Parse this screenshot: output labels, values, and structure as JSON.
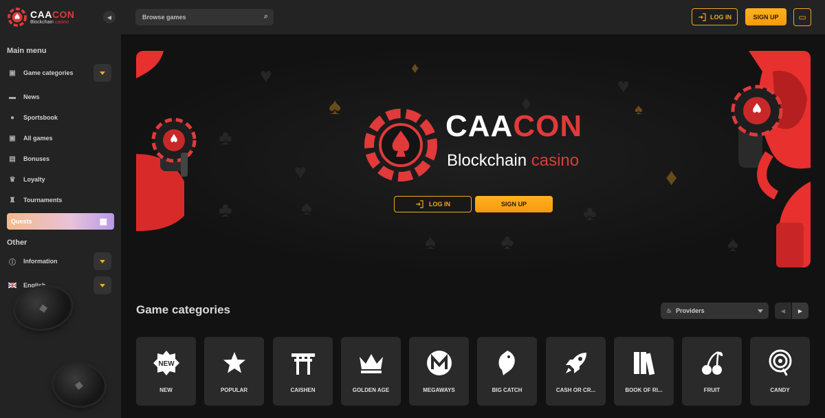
{
  "brand": {
    "name_white": "CAA",
    "name_red": "CON",
    "sub_white": "Blockchain",
    "sub_red": "casino",
    "accent": "#f5a623",
    "red": "#e03a3a"
  },
  "sidebar": {
    "main_menu_title": "Main menu",
    "items": [
      {
        "label": "Game categories",
        "icon": "gamepad-icon",
        "expandable": true
      },
      {
        "label": "News",
        "icon": "chat-bubble-icon",
        "expandable": false
      },
      {
        "label": "Sportsbook",
        "icon": "ball-icon",
        "expandable": false
      },
      {
        "label": "All games",
        "icon": "gamepad-icon",
        "expandable": false
      },
      {
        "label": "Bonuses",
        "icon": "gift-icon",
        "expandable": false
      },
      {
        "label": "Loyalty",
        "icon": "crown-icon",
        "expandable": false
      },
      {
        "label": "Tournaments",
        "icon": "trophy-icon",
        "expandable": false
      }
    ],
    "quests_label": "Quests",
    "other_title": "Other",
    "other_items": [
      {
        "label": "Information",
        "icon": "info-icon",
        "expandable": true
      },
      {
        "label": "English",
        "icon": "uk-flag-icon",
        "expandable": true
      }
    ]
  },
  "topbar": {
    "search_placeholder": "Browse games",
    "login_label": "LOG IN",
    "signup_label": "SIGN UP"
  },
  "hero": {
    "login_label": "LOG IN",
    "signup_label": "SIGN UP"
  },
  "categories": {
    "title": "Game categories",
    "providers_label": "Providers",
    "items": [
      {
        "label": "NEW",
        "icon": "new-badge-icon"
      },
      {
        "label": "POPULAR",
        "icon": "star-icon"
      },
      {
        "label": "CAISHEN",
        "icon": "torii-gate-icon"
      },
      {
        "label": "GOLDEN AGE",
        "icon": "crown-icon"
      },
      {
        "label": "MEGAWAYS",
        "icon": "megaways-icon"
      },
      {
        "label": "BIG CATCH",
        "icon": "fish-icon"
      },
      {
        "label": "CASH OR CR...",
        "icon": "rocket-icon"
      },
      {
        "label": "BOOK OF RI...",
        "icon": "books-icon"
      },
      {
        "label": "FRUIT",
        "icon": "cherry-icon"
      },
      {
        "label": "CANDY",
        "icon": "lollipop-icon"
      }
    ]
  }
}
